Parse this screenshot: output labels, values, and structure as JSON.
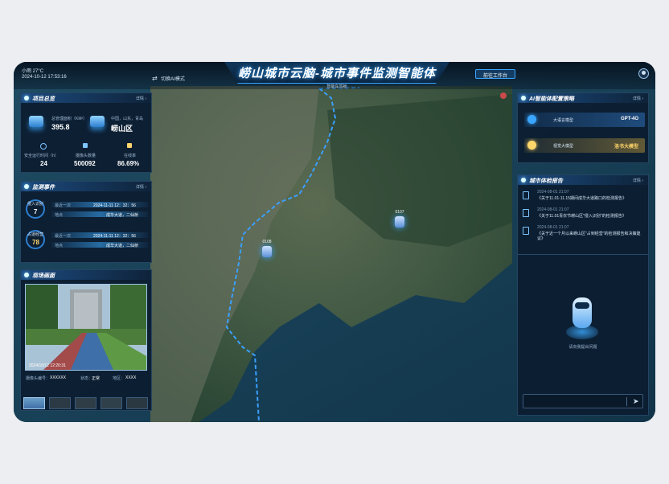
{
  "header": {
    "weather": "小雨 27°C",
    "datetime": "2024-10-12  17:53:16",
    "switch_label": "切换AI模式",
    "title": "崂山城市云脑-城市事件监测智能体",
    "subtitle": "智能车驾舱",
    "workbench_button": "前往工作台"
  },
  "project": {
    "title": "项目总览",
    "more": "详情",
    "area_label": "总管理面积（KM²）",
    "area_value": "395.8",
    "region_label": "中国，山东，青岛",
    "region_value": "崂山区",
    "stats": [
      {
        "label": "安全运行时间（h）",
        "value": "24"
      },
      {
        "label": "摄像头数量",
        "value": "500092"
      },
      {
        "label": "在线率",
        "value": "86.69%"
      }
    ]
  },
  "monitor": {
    "title": "监测事件",
    "more": "详情",
    "items": [
      {
        "name": "侵入识别",
        "count": "7",
        "recent_label": "最近一次",
        "recent_time": "2024-11-11 12：32：56",
        "place_label": "地点",
        "place_value": "成华大道，二仙桥"
      },
      {
        "name": "占道经营",
        "count": "78",
        "recent_label": "最近一次",
        "recent_time": "2024-11-11 12：32：56",
        "place_label": "地点",
        "place_value": "成华大道，二仙桥"
      }
    ]
  },
  "live": {
    "title": "现场画面",
    "timestamp": "2024/10/12   12:20:31",
    "camera_label": "摄像头编号：",
    "camera_value": "XXXXXX",
    "status_label": "状态：",
    "status_value": "正常",
    "place_label": "地区：",
    "place_value": "XXXX"
  },
  "map": {
    "markers": [
      "0107",
      "0108"
    ]
  },
  "ai_config": {
    "title": "AI智能体配置策略",
    "more": "详情",
    "rows": [
      {
        "label": "大语言模型",
        "value": "GPT-4O"
      },
      {
        "label": "视觉大模型",
        "value": "洛书大模型"
      }
    ]
  },
  "reports": {
    "title": "城市体检报告",
    "more": "详情",
    "items": [
      {
        "date": "2024-08-01 21:07",
        "text": "《关于11.01-11.15期间成华大道路口的检测报告》"
      },
      {
        "date": "2024-08-01 21:07",
        "text": "《关于11.01青衣节崂山区\"侵入识别\"的检测报告》"
      },
      {
        "date": "2024-08-01 21:07",
        "text": "《关于近一个月以来崂山区\"占到经营\"的检测报告和决策建议》"
      }
    ]
  },
  "assistant": {
    "hint": "请向我提出问题",
    "input_placeholder": ""
  },
  "colors": {
    "accent": "#3aa6ff",
    "gold": "#ffd66b",
    "boundary": "#3aa0ff"
  }
}
